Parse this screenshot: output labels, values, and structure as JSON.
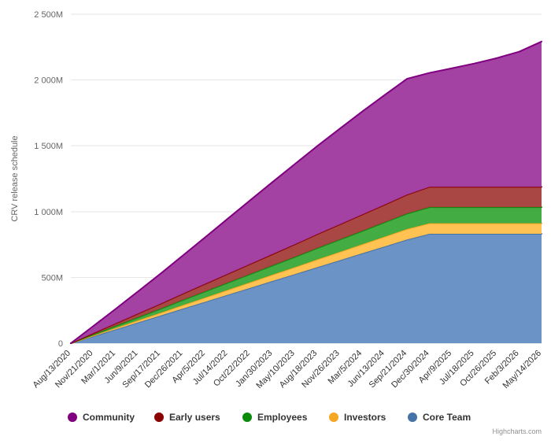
{
  "chart_data": {
    "type": "area",
    "stacked": true,
    "title": "",
    "subtitle": "",
    "xlabel": "",
    "ylabel": "CRV release schedule",
    "ylim": [
      0,
      2500
    ],
    "y_unit": "M",
    "y_ticks": [
      0,
      500,
      1000,
      1500,
      2000,
      2500
    ],
    "y_tick_labels": [
      "0",
      "500M",
      "1 000M",
      "1 500M",
      "2 000M",
      "2 500M"
    ],
    "grid": true,
    "legend_position": "bottom",
    "credit": "Highcharts.com",
    "categories": [
      "Aug/13/2020",
      "Nov/21/2020",
      "Mar/1/2021",
      "Jun/9/2021",
      "Sep/17/2021",
      "Dec/26/2021",
      "Apr/5/2022",
      "Jul/14/2022",
      "Oct/22/2022",
      "Jan/30/2023",
      "May/10/2023",
      "Aug/18/2023",
      "Nov/26/2023",
      "Mar/5/2024",
      "Jun/13/2024",
      "Sep/21/2024",
      "Dec/30/2024",
      "Apr/9/2025",
      "Jul/18/2025",
      "Oct/26/2025",
      "Feb/3/2026",
      "May/14/2026"
    ],
    "series": [
      {
        "name": "Core Team",
        "color": "#6690c4",
        "line_color": "#4572A7",
        "values": [
          0,
          53,
          105,
          158,
          210,
          263,
          315,
          368,
          420,
          473,
          525,
          578,
          630,
          683,
          735,
          788,
          831,
          831,
          831,
          831,
          831,
          831
        ]
      },
      {
        "name": "Investors",
        "color": "#ffc04d",
        "line_color": "#f5a623",
        "values": [
          0,
          5,
          11,
          16,
          21,
          27,
          32,
          37,
          43,
          48,
          53,
          59,
          64,
          69,
          75,
          80,
          80,
          80,
          80,
          80,
          80,
          80
        ]
      },
      {
        "name": "Employees",
        "color": "#3da93d",
        "line_color": "#0b8a0b",
        "values": [
          0,
          8,
          16,
          23,
          31,
          39,
          47,
          55,
          62,
          70,
          78,
          86,
          94,
          101,
          109,
          117,
          123,
          123,
          123,
          123,
          123,
          123
        ]
      },
      {
        "name": "Early users",
        "color": "#a6413f",
        "line_color": "#8b0000",
        "values": [
          0,
          10,
          19,
          29,
          38,
          48,
          58,
          67,
          77,
          86,
          96,
          106,
          115,
          125,
          134,
          144,
          154,
          154,
          154,
          154,
          154,
          154
        ]
      },
      {
        "name": "Community",
        "color": "#a03ca0",
        "line_color": "#800080",
        "values": [
          0,
          54,
          110,
          168,
          228,
          290,
          354,
          419,
          484,
          548,
          610,
          670,
          727,
          782,
          833,
          880,
          866,
          901,
          937,
          978,
          1027,
          1104
        ]
      }
    ],
    "stack_totals": [
      0,
      130,
      261,
      394,
      528,
      667,
      806,
      946,
      1086,
      1225,
      1362,
      1499,
      1630,
      1760,
      1886,
      2009,
      2054,
      2089,
      2125,
      2166,
      2215,
      2292
    ]
  },
  "legend": {
    "items": [
      {
        "label": "Community",
        "color": "#800080"
      },
      {
        "label": "Early users",
        "color": "#8b0000"
      },
      {
        "label": "Employees",
        "color": "#0b8a0b"
      },
      {
        "label": "Investors",
        "color": "#f5a623"
      },
      {
        "label": "Core Team",
        "color": "#4572A7"
      }
    ]
  },
  "credit": {
    "text": "Highcharts.com"
  }
}
